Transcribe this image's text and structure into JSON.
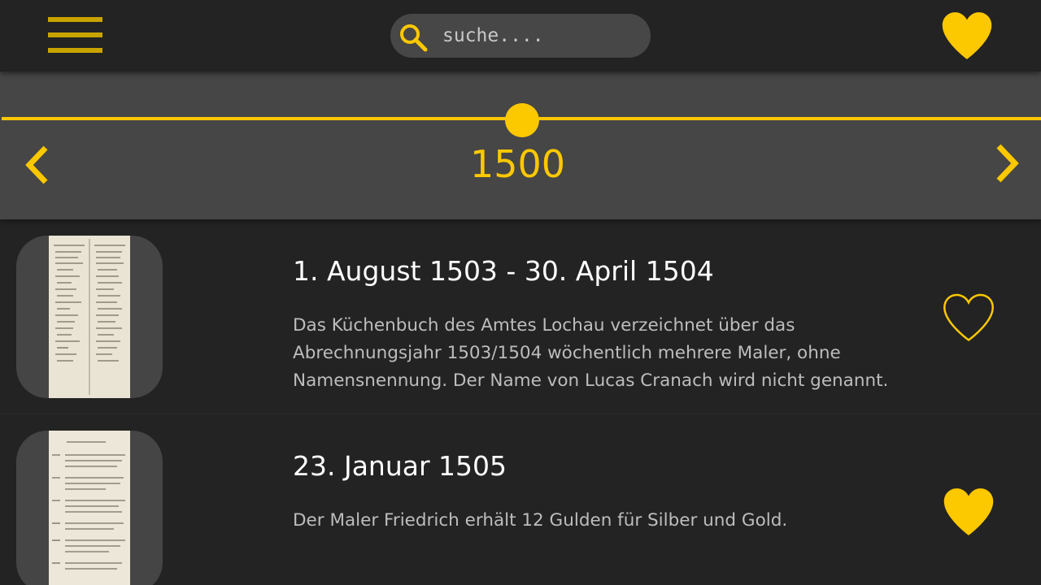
{
  "colors": {
    "accent": "#fcc800",
    "background": "#232323",
    "panel": "#464646",
    "text": "#ffffff",
    "muted_text": "#bdbdbd"
  },
  "header": {
    "menu_icon": "hamburger-menu-icon",
    "search": {
      "icon": "search-icon",
      "placeholder": "suche...."
    },
    "favorites_icon": "heart-filled-icon"
  },
  "timeline": {
    "year": "1500",
    "prev_icon": "chevron-left-icon",
    "next_icon": "chevron-right-icon",
    "slider_value_fraction": 0.5
  },
  "entries": [
    {
      "title": "1. August 1503 - 30. April 1504",
      "description": "Das Küchenbuch des Amtes Lochau verzeichnet über das Abrechnungsjahr 1503/1504 wöchentlich mehrere Maler, ohne Namensnennung. Der Name von Lucas Cranach wird nicht genannt.",
      "favorite": false,
      "favorite_icon": "heart-outline-icon",
      "thumbnail_icon": "manuscript-thumbnail-icon"
    },
    {
      "title": "23. Januar 1505",
      "description": "Der Maler Friedrich erhält 12 Gulden für Silber und Gold.",
      "favorite": true,
      "favorite_icon": "heart-filled-icon",
      "thumbnail_icon": "manuscript-thumbnail-icon"
    }
  ]
}
